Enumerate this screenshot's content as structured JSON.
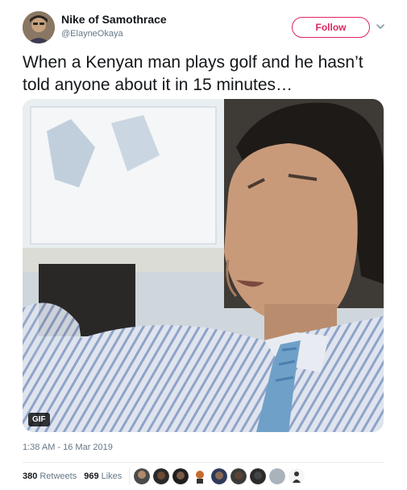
{
  "user": {
    "display_name": "Nike of Samothrace",
    "handle": "@ElayneOkaya"
  },
  "actions": {
    "follow_label": "Follow",
    "caret_icon": "chevron-down-icon"
  },
  "tweet": {
    "text": "When a Kenyan man plays golf and he hasn’t told anyone about it in 15 minutes…",
    "media_badge": "GIF",
    "timestamp": "1:38 AM - 16 Mar 2019"
  },
  "stats": {
    "retweets_count": "380",
    "retweets_label": "Retweets",
    "likes_count": "969",
    "likes_label": "Likes"
  },
  "likers": [
    {
      "icon": "liker-avatar"
    },
    {
      "icon": "liker-avatar"
    },
    {
      "icon": "liker-avatar"
    },
    {
      "icon": "liker-avatar"
    },
    {
      "icon": "liker-avatar"
    },
    {
      "icon": "liker-avatar"
    },
    {
      "icon": "liker-avatar"
    },
    {
      "icon": "liker-avatar"
    },
    {
      "icon": "liker-avatar"
    }
  ],
  "colors": {
    "accent": "#e0245e",
    "text": "#14171a",
    "secondary_text": "#657786",
    "divider": "#e6ecf0"
  }
}
